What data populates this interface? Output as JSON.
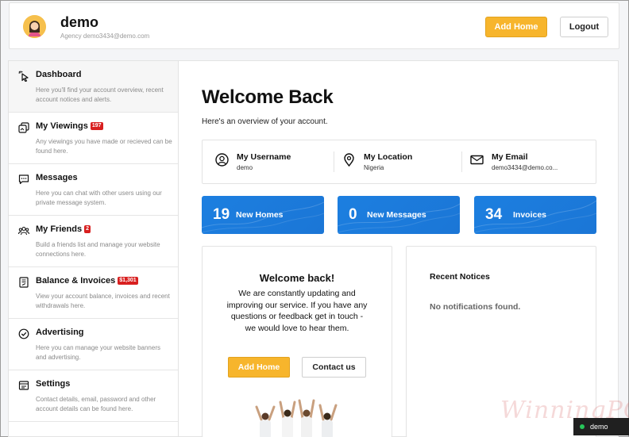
{
  "header": {
    "user_name": "demo",
    "user_role": "Agency",
    "user_email": "demo3434@demo.com",
    "add_home_label": "Add Home",
    "logout_label": "Logout"
  },
  "sidebar": {
    "items": [
      {
        "label": "Dashboard",
        "desc": "Here you'll find your account overview, recent account notices and alerts.",
        "icon": "pointer-click-icon",
        "badge": ""
      },
      {
        "label": "My Viewings",
        "desc": "Any viewings you have made or recieved can be found here.",
        "icon": "viewings-icon",
        "badge": "197"
      },
      {
        "label": "Messages",
        "desc": "Here you can chat with other users using our private message system.",
        "icon": "chat-icon",
        "badge": ""
      },
      {
        "label": "My Friends",
        "desc": "Build a friends list and manage your website connections here.",
        "icon": "friends-icon",
        "badge": "2"
      },
      {
        "label": "Balance & Invoices",
        "desc": "View your account balance, invoices and recent withdrawals here.",
        "icon": "invoice-icon",
        "badge": "$1,301"
      },
      {
        "label": "Advertising",
        "desc": "Here you can manage your website banners and advertising.",
        "icon": "check-circle-icon",
        "badge": ""
      },
      {
        "label": "Settings",
        "desc": "Contact details, email, password and other account details can be found here.",
        "icon": "settings-icon",
        "badge": ""
      }
    ]
  },
  "main": {
    "title": "Welcome Back",
    "subtitle": "Here's an overview of your account.",
    "info": [
      {
        "label": "My Username",
        "value": "demo",
        "icon": "user-circle-icon"
      },
      {
        "label": "My Location",
        "value": "Nigeria",
        "icon": "location-pin-icon"
      },
      {
        "label": "My Email",
        "value": "demo3434@demo.co...",
        "icon": "envelope-icon"
      }
    ],
    "stats": [
      {
        "number": "19",
        "label": "New Homes"
      },
      {
        "number": "0",
        "label": "New Messages"
      },
      {
        "number": "34",
        "label": "Invoices"
      }
    ],
    "welcome_card": {
      "title": "Welcome back!",
      "text": "We are constantly updating and improving our service. If you have any questions or feedback get in touch - we would love to hear them.",
      "add_home_label": "Add Home",
      "contact_label": "Contact us"
    },
    "notices": {
      "title": "Recent Notices",
      "empty": "No notifications found."
    }
  },
  "watermark": "WinningPC",
  "status": {
    "label": "demo",
    "color": "#27c55a"
  },
  "colors": {
    "accent": "#f7b52c",
    "stat_blue": "#1b78d9",
    "badge_red": "#d81f1f"
  }
}
